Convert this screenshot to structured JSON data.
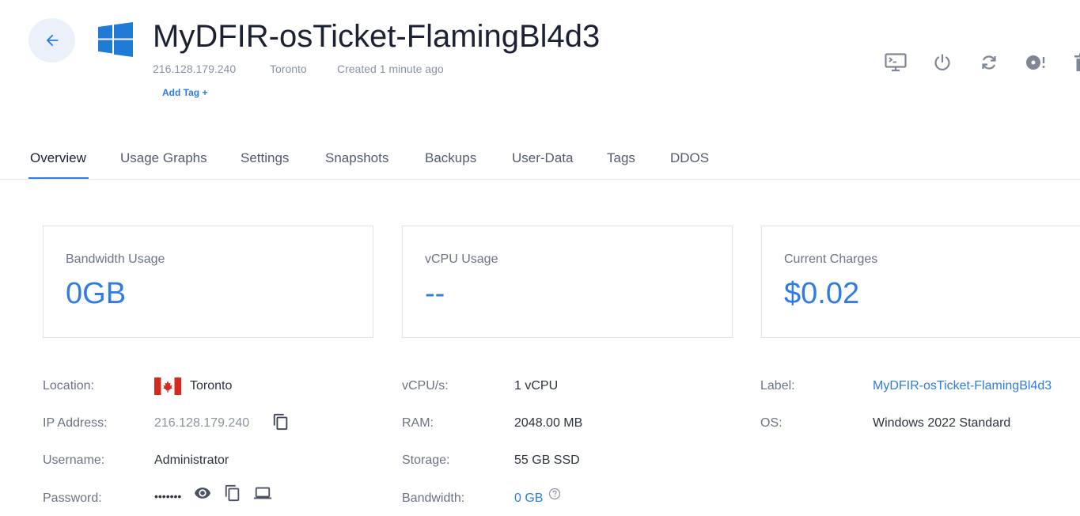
{
  "header": {
    "title": "MyDFIR-osTicket-FlamingBl4d3",
    "ip": "216.128.179.240",
    "location": "Toronto",
    "created": "Created 1 minute ago",
    "add_tag": "Add Tag +"
  },
  "actions": [
    {
      "icon": "console-icon"
    },
    {
      "icon": "power-icon"
    },
    {
      "icon": "restart-icon"
    },
    {
      "icon": "iso-icon"
    },
    {
      "icon": "trash-icon"
    }
  ],
  "tabs": [
    {
      "label": "Overview",
      "active": true
    },
    {
      "label": "Usage Graphs"
    },
    {
      "label": "Settings"
    },
    {
      "label": "Snapshots"
    },
    {
      "label": "Backups"
    },
    {
      "label": "User-Data"
    },
    {
      "label": "Tags"
    },
    {
      "label": "DDOS"
    }
  ],
  "cards": [
    {
      "label": "Bandwidth Usage",
      "value": "0GB"
    },
    {
      "label": "vCPU Usage",
      "value": "--"
    },
    {
      "label": "Current Charges",
      "value": "$0.02"
    }
  ],
  "details": {
    "location_label": "Location:",
    "location_value": "Toronto",
    "ip_label": "IP Address:",
    "ip_value": "216.128.179.240",
    "username_label": "Username:",
    "username_value": "Administrator",
    "password_label": "Password:",
    "password_value": "•••••••",
    "vcpu_label": "vCPU/s:",
    "vcpu_value": "1 vCPU",
    "ram_label": "RAM:",
    "ram_value": "2048.00 MB",
    "storage_label": "Storage:",
    "storage_value": "55 GB SSD",
    "bandwidth_label": "Bandwidth:",
    "bandwidth_value": "0 GB",
    "label_label": "Label:",
    "label_value": "MyDFIR-osTicket-FlamingBl4d3",
    "os_label": "OS:",
    "os_value": "Windows 2022 Standard"
  },
  "colors": {
    "accent": "#2e7ce4",
    "title": "#1c2133",
    "muted": "#8a93a3",
    "flag_red": "#d52b1e"
  }
}
